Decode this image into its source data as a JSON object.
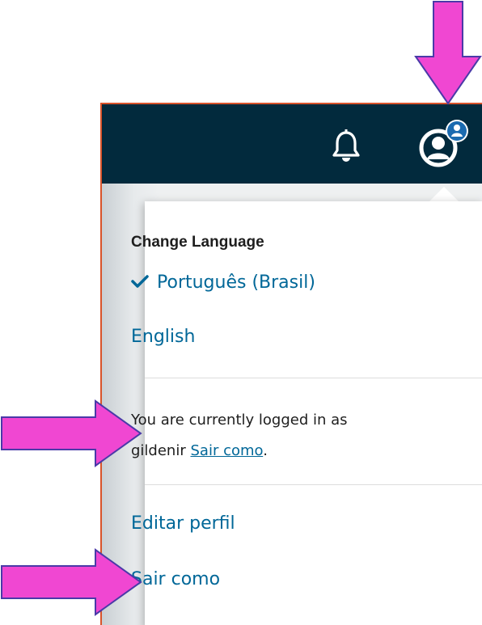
{
  "colors": {
    "topbar": "#022a3d",
    "link": "#006798",
    "text": "#1e1e1e",
    "annotation_arrow": "#f047d2",
    "frame_border": "#d9532b"
  },
  "header": {
    "bell_icon": "bell-icon",
    "user_icon": "user-account-icon"
  },
  "dropdown": {
    "language_title": "Change Language",
    "languages": [
      {
        "label": "Português (Brasil)",
        "selected": true
      },
      {
        "label": "English",
        "selected": false
      }
    ],
    "logged_in": {
      "prefix": "You are currently logged in as",
      "username": "gildenir",
      "link": "Sair como",
      "suffix": "."
    },
    "menu": {
      "edit_profile": "Editar perfil",
      "logout": "Sair como"
    }
  },
  "annotations": {
    "arrow_icon": "arrow-icon"
  }
}
